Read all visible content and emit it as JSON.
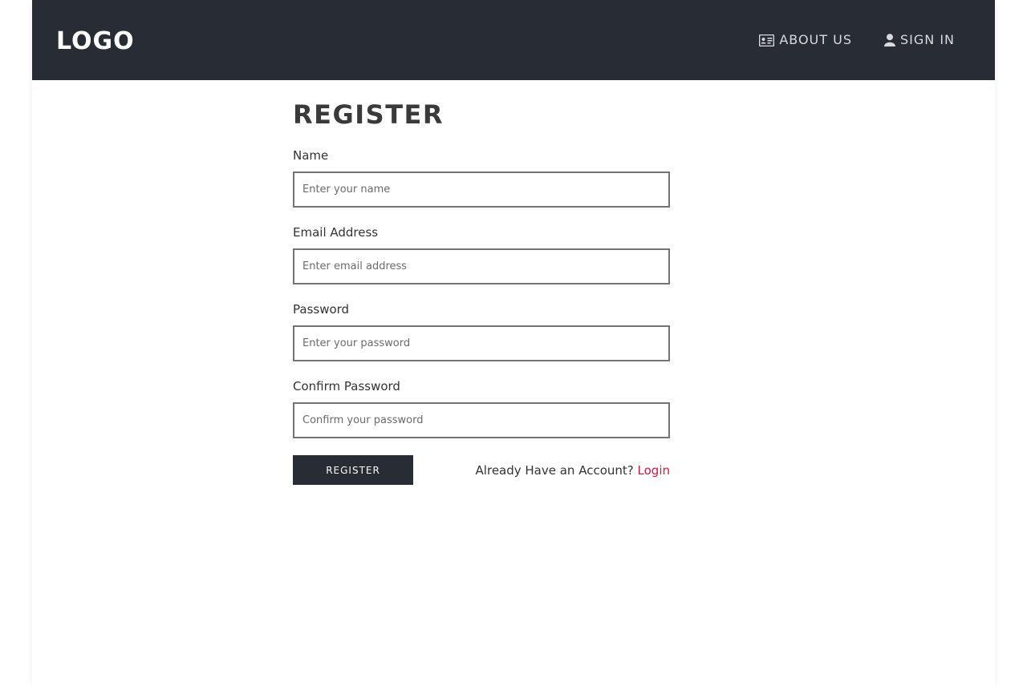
{
  "navbar": {
    "logo": "LOGO",
    "links": [
      {
        "label": "ABOUT US",
        "icon": "id-card-icon"
      },
      {
        "label": "SIGN IN",
        "icon": "user-icon"
      }
    ]
  },
  "form": {
    "title": "REGISTER",
    "fields": [
      {
        "label": "Name",
        "placeholder": "Enter your name",
        "value": ""
      },
      {
        "label": "Email Address",
        "placeholder": "Enter email address",
        "value": ""
      },
      {
        "label": "Password",
        "placeholder": "Enter your password",
        "value": ""
      },
      {
        "label": "Confirm Password",
        "placeholder": "Confirm your password",
        "value": ""
      }
    ],
    "submit_label": "REGISTER",
    "account_prompt": "Already Have an Account?",
    "login_label": "Login"
  },
  "colors": {
    "navbar_bg": "#282c34",
    "accent": "#d6163f",
    "button_bg": "#282c34"
  }
}
